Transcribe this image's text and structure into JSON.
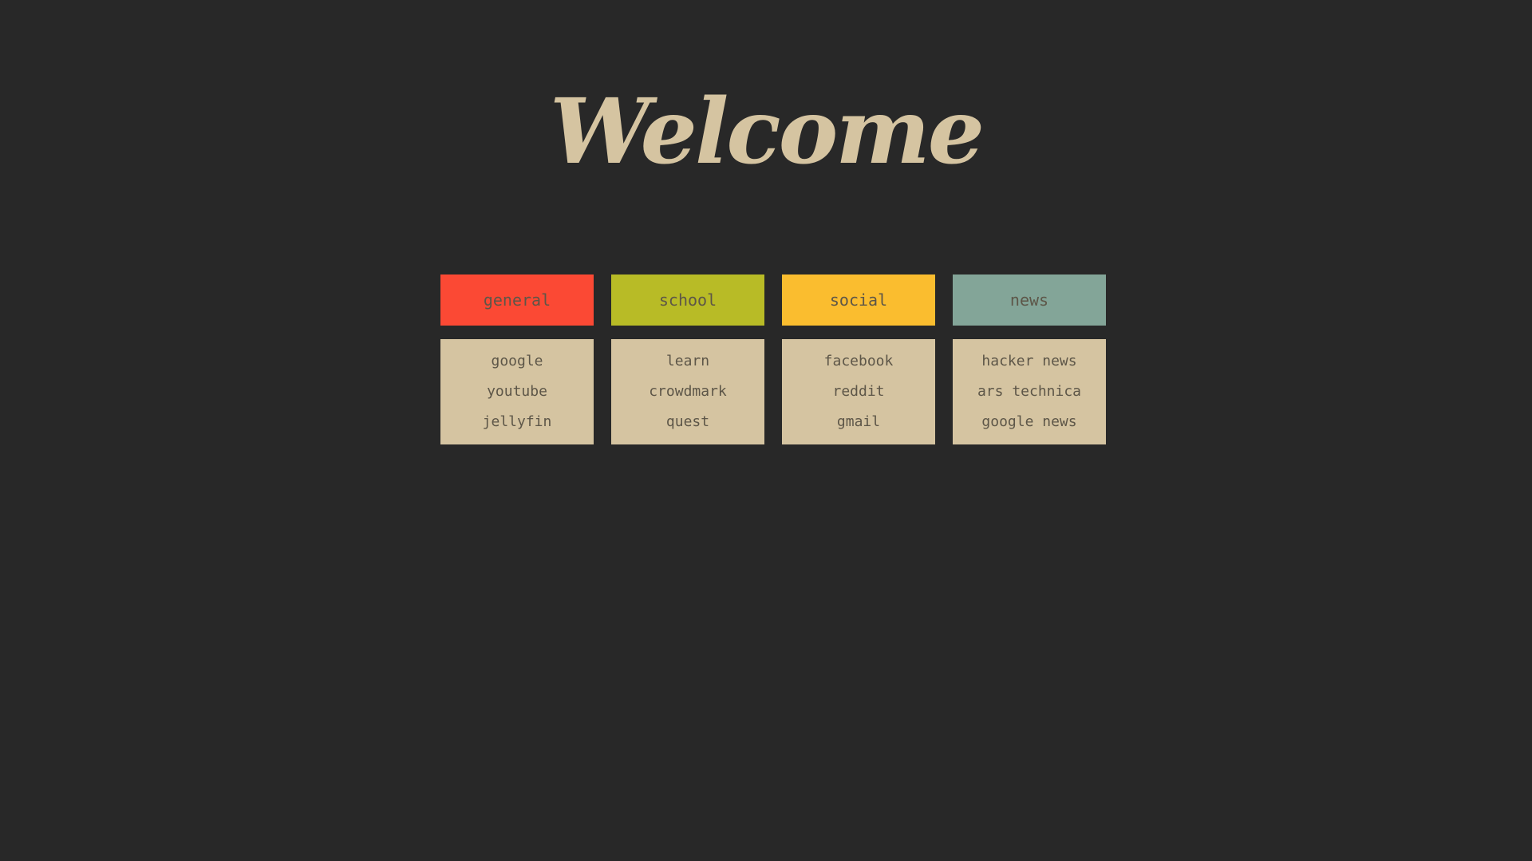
{
  "page": {
    "title": "Welcome"
  },
  "colors": {
    "background": "#282828",
    "text_light": "#d5c4a1",
    "text_dark": "#5d5648",
    "links_bg": "#d5c4a1"
  },
  "categories": [
    {
      "name": "general",
      "color": "#fb4934",
      "links": [
        "google",
        "youtube",
        "jellyfin"
      ]
    },
    {
      "name": "school",
      "color": "#b8bb26",
      "links": [
        "learn",
        "crowdmark",
        "quest"
      ]
    },
    {
      "name": "social",
      "color": "#fabd2f",
      "links": [
        "facebook",
        "reddit",
        "gmail"
      ]
    },
    {
      "name": "news",
      "color": "#83a598",
      "links": [
        "hacker news",
        "ars technica",
        "google news"
      ]
    }
  ]
}
